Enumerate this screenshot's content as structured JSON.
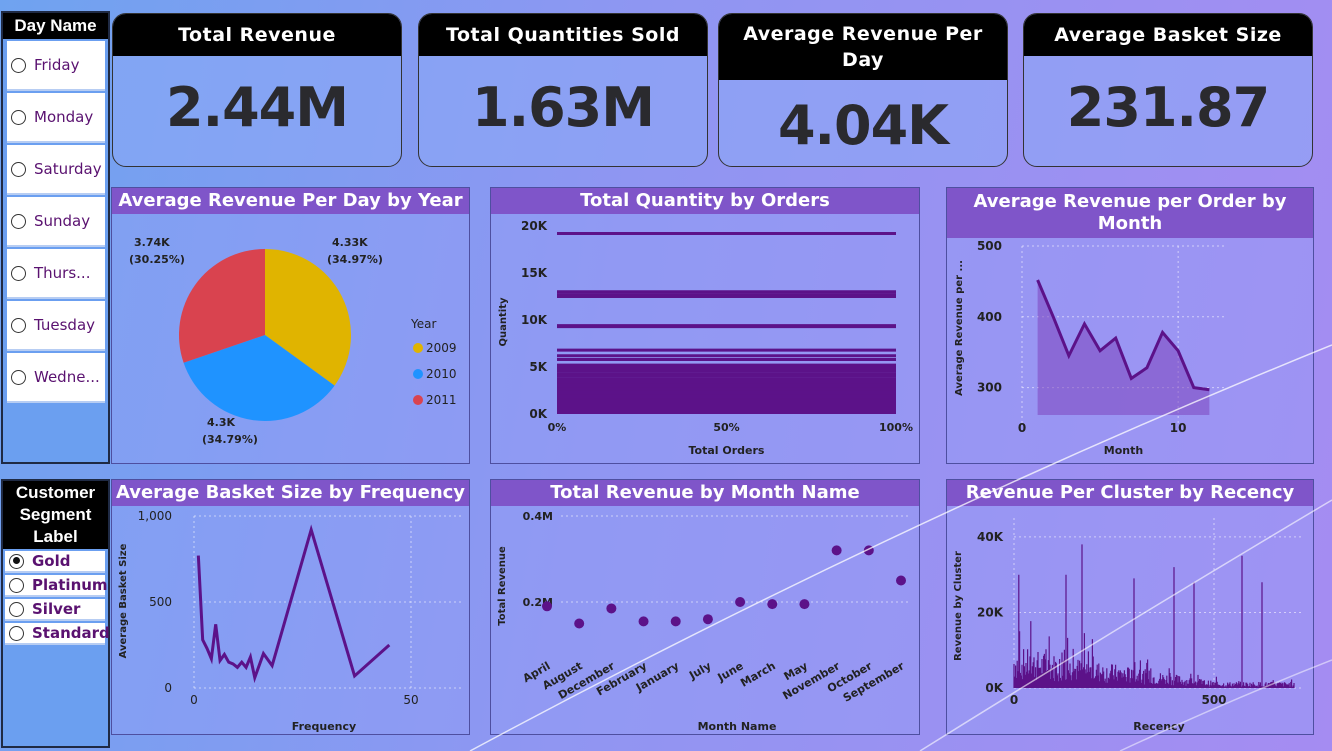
{
  "day_slicer": {
    "title": "Day Name",
    "items": [
      "Friday",
      "Monday",
      "Saturday",
      "Sunday",
      "Thurs...",
      "Tuesday",
      "Wedne..."
    ]
  },
  "segment_slicer": {
    "title_line1": "Customer",
    "title_line2": "Segment",
    "title_line3": "Label",
    "items": [
      "Gold",
      "Platinum",
      "Silver",
      "Standard"
    ],
    "selected": "Gold"
  },
  "kpis": {
    "total_revenue": {
      "label": "Total Revenue",
      "value": "2.44M"
    },
    "total_quantities": {
      "label": "Total Quantities Sold",
      "value": "1.63M"
    },
    "avg_revenue_day": {
      "label_line1": "Average Revenue Per",
      "label_line2": "Day",
      "value": "4.04K"
    },
    "avg_basket": {
      "label": "Average Basket Size",
      "value": "231.87"
    }
  },
  "charts": {
    "pie": {
      "title": "Average Revenue Per Day by Year",
      "legend_title": "Year"
    },
    "quantity": {
      "title": "Total Quantity by Orders",
      "xlabel": "Total Orders",
      "ylabel": "Quantity"
    },
    "rev_order_month": {
      "title_line1": "Average Revenue per Order by",
      "title_line2": "Month",
      "xlabel": "Month",
      "ylabel": "Average Revenue per ..."
    },
    "basket_freq": {
      "title": "Average Basket Size by Frequency",
      "xlabel": "Frequency",
      "ylabel": "Average Basket Size"
    },
    "rev_month_name": {
      "title": "Total Revenue by Month Name",
      "xlabel": "Month Name",
      "ylabel": "Total Revenue"
    },
    "rev_cluster": {
      "title": "Revenue Per Cluster by Recency",
      "xlabel": "Recency",
      "ylabel": "Revenue by Cluster"
    }
  },
  "chart_data": [
    {
      "type": "pie",
      "title": "Average Revenue Per Day by Year",
      "legend_title": "Year",
      "slices": [
        {
          "label": "2009",
          "value": 4.33,
          "display": "4.33K",
          "pct": "(34.97%)",
          "color": "#e0b400"
        },
        {
          "label": "2010",
          "value": 4.3,
          "display": "4.3K",
          "pct": "(34.79%)",
          "color": "#1f93ff"
        },
        {
          "label": "2011",
          "value": 3.74,
          "display": "3.74K",
          "pct": "(30.25%)",
          "color": "#d9434f"
        }
      ]
    },
    {
      "type": "bar",
      "title": "Total Quantity by Orders",
      "xlabel": "Total Orders",
      "ylabel": "Quantity",
      "ylim": [
        0,
        20000
      ],
      "yticks": [
        "0K",
        "5K",
        "10K",
        "15K",
        "20K"
      ],
      "xticks": [
        "0%",
        "50%",
        "100%"
      ],
      "values": [
        19200,
        13000,
        12700,
        12500,
        9400,
        9300,
        6800,
        6200,
        5800,
        5200,
        4900,
        4600,
        4300,
        4000,
        3700,
        3400,
        3100,
        2900,
        2700,
        2500,
        2300,
        2100,
        1900,
        1700,
        1500,
        1300,
        1100,
        900,
        700,
        500
      ]
    },
    {
      "type": "area",
      "title": "Average Revenue per Order by Month",
      "xlabel": "Month",
      "ylabel": "Average Revenue per ...",
      "x": [
        1,
        2,
        3,
        4,
        5,
        6,
        7,
        8,
        9,
        10,
        11,
        12
      ],
      "y": [
        452,
        400,
        345,
        390,
        352,
        370,
        313,
        328,
        378,
        352,
        300,
        297
      ],
      "ylim": [
        250,
        500
      ],
      "xlim": [
        0,
        13
      ],
      "yticks": [
        "300",
        "400",
        "500"
      ],
      "xticks": [
        "0",
        "10"
      ]
    },
    {
      "type": "line",
      "title": "Average Basket Size by Frequency",
      "xlabel": "Frequency",
      "ylabel": "Average Basket Size",
      "x": [
        1,
        2,
        3,
        4,
        5,
        6,
        7,
        8,
        9,
        10,
        11,
        12,
        13,
        14,
        16,
        18,
        27,
        37,
        45
      ],
      "y": [
        770,
        280,
        230,
        170,
        370,
        160,
        195,
        150,
        140,
        120,
        150,
        120,
        180,
        60,
        200,
        130,
        920,
        70,
        250
      ],
      "ylim": [
        0,
        1000
      ],
      "xlim": [
        0,
        50
      ],
      "yticks": [
        "0",
        "500",
        "1,000"
      ],
      "xticks": [
        "0",
        "50"
      ]
    },
    {
      "type": "scatter",
      "title": "Total Revenue by Month Name",
      "xlabel": "Month Name",
      "ylabel": "Total Revenue",
      "categories": [
        "April",
        "August",
        "December",
        "February",
        "January",
        "July",
        "June",
        "March",
        "May",
        "November",
        "October",
        "September"
      ],
      "values": [
        0.19,
        0.15,
        0.185,
        0.155,
        0.155,
        0.16,
        0.2,
        0.195,
        0.195,
        0.32,
        0.32,
        0.25
      ],
      "ylim": [
        0,
        0.4
      ],
      "yticks": [
        "0.2M",
        "0.4M"
      ]
    },
    {
      "type": "bar",
      "title": "Revenue Per Cluster by Recency",
      "xlabel": "Recency",
      "ylabel": "Revenue by Cluster",
      "ylim": [
        0,
        45000
      ],
      "xlim": [
        0,
        720
      ],
      "yticks": [
        "0K",
        "20K",
        "40K"
      ],
      "xticks": [
        "0",
        "500"
      ]
    }
  ]
}
